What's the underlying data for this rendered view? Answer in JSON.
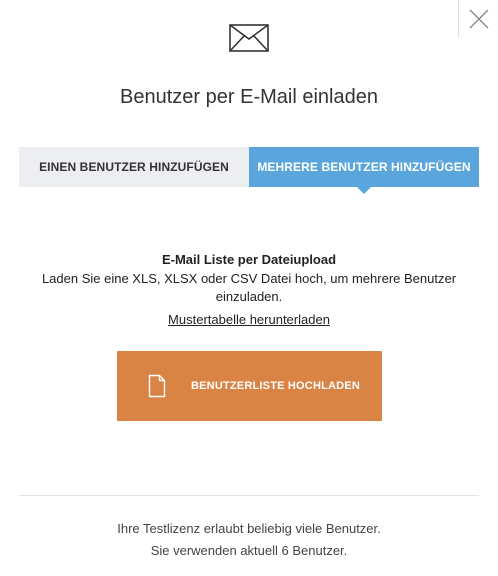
{
  "dialog": {
    "title": "Benutzer per E-Mail einladen",
    "icon": "envelope-icon",
    "close_icon": "close-icon"
  },
  "tabs": [
    {
      "label": "EINEN BENUTZER HINZUFÜGEN",
      "active": false
    },
    {
      "label": "MEHRERE BENUTZER HINZUFÜGEN",
      "active": true
    }
  ],
  "upload": {
    "title": "E-Mail Liste per Dateiupload",
    "description": "Laden Sie eine XLS, XLSX oder CSV Datei hoch, um mehrere Benutzer einzuladen.",
    "template_link": "Mustertabelle herunterladen",
    "button_label": "BENUTZERLISTE HOCHLADEN",
    "button_icon": "file-icon"
  },
  "footer": {
    "line1": "Ihre Testlizenz erlaubt beliebig viele Benutzer.",
    "line2": "Sie verwenden aktuell 6 Benutzer."
  },
  "colors": {
    "tab_active": "#5aa5dc",
    "tab_inactive": "#eceef1",
    "upload_button": "#d98445"
  }
}
